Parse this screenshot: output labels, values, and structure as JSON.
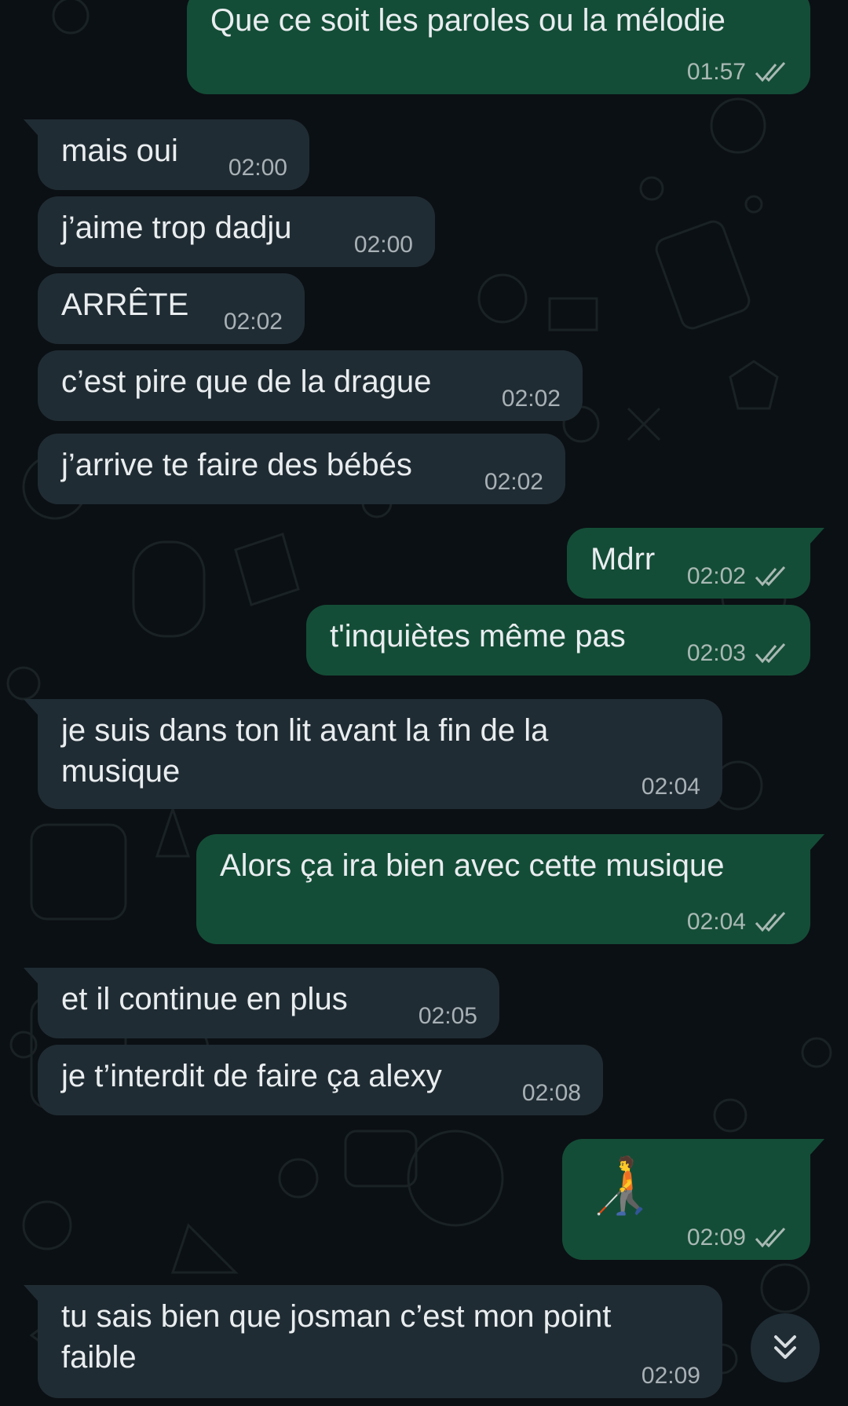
{
  "messages": [
    {
      "id": "m1",
      "direction": "out",
      "text": "Que ce soit les paroles ou la mélodie",
      "time": "01:57",
      "status": "read"
    },
    {
      "id": "m2",
      "direction": "in",
      "text": "mais oui",
      "time": "02:00"
    },
    {
      "id": "m3",
      "direction": "in",
      "text": "j’aime trop dadju",
      "time": "02:00"
    },
    {
      "id": "m4",
      "direction": "in",
      "text": "ARRÊTE",
      "time": "02:02"
    },
    {
      "id": "m5",
      "direction": "in",
      "text": "c’est pire que de la drague",
      "time": "02:02"
    },
    {
      "id": "m6",
      "direction": "in",
      "text": "j’arrive te faire des bébés",
      "time": "02:02"
    },
    {
      "id": "m7",
      "direction": "out",
      "text": "Mdrr",
      "time": "02:02",
      "status": "read"
    },
    {
      "id": "m8",
      "direction": "out",
      "text": "t'inquiètes même pas",
      "time": "02:03",
      "status": "read"
    },
    {
      "id": "m9",
      "direction": "in",
      "text": "je suis dans ton lit avant la fin de la\nmusique",
      "time": "02:04"
    },
    {
      "id": "m10",
      "direction": "out",
      "text": "Alors ça ira bien avec cette musique",
      "time": "02:04",
      "status": "read"
    },
    {
      "id": "m11",
      "direction": "in",
      "text": "et il continue en plus",
      "time": "02:05"
    },
    {
      "id": "m12",
      "direction": "in",
      "text": "je t’interdit de faire ça alexy",
      "time": "02:08"
    },
    {
      "id": "m13",
      "direction": "out",
      "text": "🧑‍🦯",
      "time": "02:09",
      "status": "read"
    },
    {
      "id": "m14",
      "direction": "in",
      "text": "tu sais bien que josman c’est mon point\nfaible",
      "time": "02:09"
    }
  ],
  "colors": {
    "background": "#0b1014",
    "incoming_bubble": "#202c33",
    "outgoing_bubble": "#144d37",
    "text": "#e9edef",
    "read_ticks": "#a9b9b4"
  },
  "icons": {
    "read_receipt": "double-check-icon",
    "scroll_down": "double-chevron-down-icon"
  }
}
